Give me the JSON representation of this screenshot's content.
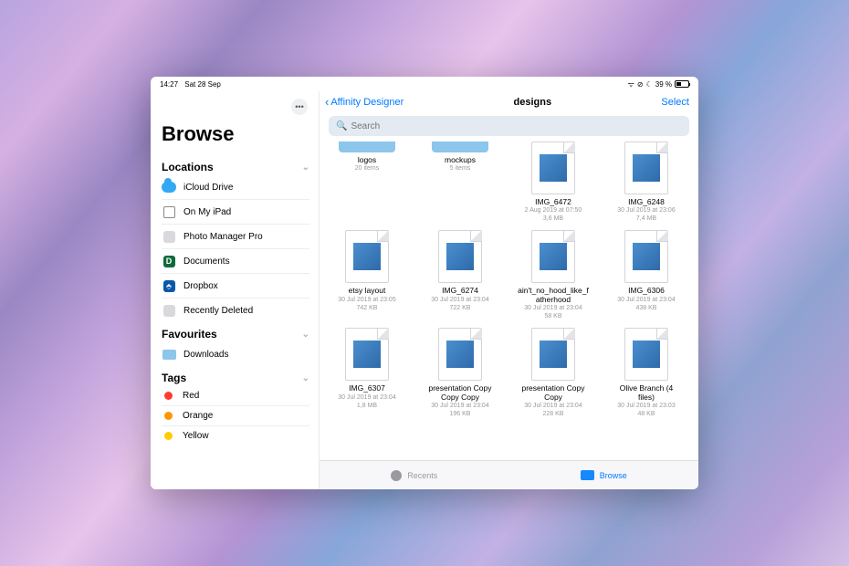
{
  "status": {
    "time": "14:27",
    "date": "Sat 28 Sep",
    "battery_pct": "39 %"
  },
  "sidebar": {
    "title": "Browse",
    "more": "•••",
    "sections": {
      "locations": {
        "label": "Locations"
      },
      "favourites": {
        "label": "Favourites"
      },
      "tags": {
        "label": "Tags"
      }
    },
    "locations": [
      {
        "label": "iCloud Drive",
        "icon": "cloud-icon"
      },
      {
        "label": "On My iPad",
        "icon": "ipad-icon"
      },
      {
        "label": "Photo Manager Pro",
        "icon": "photomgr-icon"
      },
      {
        "label": "Documents",
        "icon": "documents-icon"
      },
      {
        "label": "Dropbox",
        "icon": "dropbox-icon"
      },
      {
        "label": "Recently Deleted",
        "icon": "trash-icon"
      }
    ],
    "favourites": [
      {
        "label": "Downloads",
        "icon": "folder-icon"
      }
    ],
    "tags": [
      {
        "label": "Red",
        "color": "#ff3b30"
      },
      {
        "label": "Orange",
        "color": "#ff9502"
      },
      {
        "label": "Yellow",
        "color": "#ffcc00"
      }
    ]
  },
  "header": {
    "back_label": "Affinity Designer",
    "title": "designs",
    "select": "Select"
  },
  "search": {
    "placeholder": "Search"
  },
  "grid": {
    "rows": [
      [
        {
          "kind": "folder",
          "name": "logos",
          "line1": "20 items",
          "line2": ""
        },
        {
          "kind": "folder",
          "name": "mockups",
          "line1": "5 items",
          "line2": ""
        },
        {
          "kind": "file",
          "name": "IMG_6472",
          "line1": "2 Aug 2019 at 07:50",
          "line2": "3,6 MB"
        },
        {
          "kind": "file",
          "name": "IMG_6248",
          "line1": "30 Jul 2019 at 23:06",
          "line2": "7,4 MB"
        }
      ],
      [
        {
          "kind": "file",
          "name": "etsy layout",
          "line1": "30 Jul 2019 at 23:05",
          "line2": "742 KB"
        },
        {
          "kind": "file",
          "name": "IMG_6274",
          "line1": "30 Jul 2019 at 23:04",
          "line2": "722 KB"
        },
        {
          "kind": "file",
          "name": "ain't_no_hood_like_fatherhood",
          "line1": "30 Jul 2019 at 23:04",
          "line2": "58 KB"
        },
        {
          "kind": "file",
          "name": "IMG_6306",
          "line1": "30 Jul 2019 at 23:04",
          "line2": "438 KB"
        }
      ],
      [
        {
          "kind": "file",
          "name": "IMG_6307",
          "line1": "30 Jul 2019 at 23:04",
          "line2": "1,8 MB"
        },
        {
          "kind": "file",
          "name": "presentation Copy Copy Copy",
          "line1": "30 Jul 2019 at 23:04",
          "line2": "196 KB"
        },
        {
          "kind": "file",
          "name": "presentation Copy Copy",
          "line1": "30 Jul 2019 at 23:04",
          "line2": "228 KB"
        },
        {
          "kind": "file",
          "name": "Olive Branch (4 files)",
          "line1": "30 Jul 2019 at 23:03",
          "line2": "48 KB"
        }
      ]
    ]
  },
  "tabs": {
    "recents": "Recents",
    "browse": "Browse"
  },
  "colors": {
    "link": "#007aff",
    "folder": "#8cc6eb"
  }
}
